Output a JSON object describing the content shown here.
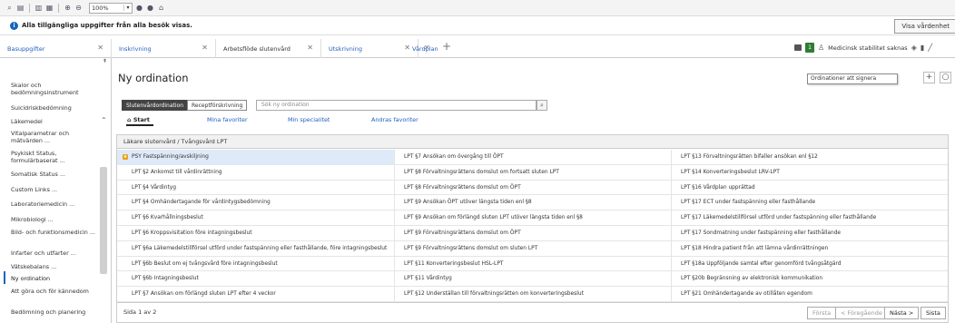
{
  "toolbar": {
    "zoom_value": "100%"
  },
  "infobar": {
    "message": "Alla tillgängliga uppgifter från alla besök visas.",
    "button_label": "Visa vårdenhet"
  },
  "tabs": [
    {
      "label": "Basuppgifter",
      "dark": false
    },
    {
      "label": "Inskrivning",
      "dark": false
    },
    {
      "label": "Arbetsflöde slutenvård",
      "dark": true
    },
    {
      "label": "Utskrivning",
      "dark": false
    },
    {
      "label": "Vårdplan",
      "dark": false
    }
  ],
  "header_status": {
    "medical_text": "Medicinsk stabilitet saknas"
  },
  "tooltip": "Ordinationer att signera",
  "sidebar": {
    "items": [
      "Skalor och bedömningsinstrument",
      "Suicidriskbedömning",
      "Läkemedel",
      "Vitalparametrar och mätvärden ...",
      "Psykiskt Status, formulärbaserat ...",
      "Somatisk Status ...",
      "Custom Links ...",
      "Laboratoriemedicin ...",
      "Mikrobiologi ...",
      "Bild- och funktionsmedicin ...",
      "Infarter och utfarter ...",
      "Vätskebalans ...",
      "Ny ordination",
      "Att göra och för kännedom",
      "Bedömning och planering"
    ]
  },
  "main": {
    "title": "Ny ordination",
    "subtabs": [
      "Slutenvårdordination",
      "Receptförskrivning"
    ],
    "search_placeholder": "Sök ny ordination",
    "nav": {
      "start": "Start",
      "favorites": "Mina favoriter",
      "specialty": "Min specialitet",
      "others": "Andras favoriter"
    },
    "breadcrumb": "Läkare slutenvård / Tvångsvård LPT",
    "rows": [
      [
        "PSY Fastspänning/avskiljning",
        "LPT §7 Ansökan om övergång till ÖPT",
        "LPT §13 Förvaltningsrätten bifaller ansökan enl §12"
      ],
      [
        "LPT §2 Ankomst till vårdinrättning",
        "LPT §8 Förvaltningsrättens domslut om fortsatt sluten LPT",
        "LPT §14 Konverteringsbeslut LRV-LPT"
      ],
      [
        "LPT §4 Vårdintyg",
        "LPT §8 Förvaltningsrättens domslut om ÖPT",
        "LPT §16 Vårdplan upprättad"
      ],
      [
        "LPT §4 Omhändertagande för vårdintygsbedömning",
        "LPT §9 Ansökan ÖPT utöver längsta tiden enl §8",
        "LPT §17 ECT under fastspänning eller fasthållande"
      ],
      [
        "LPT §6 Kvarhållningsbeslut",
        "LPT §9 Ansökan om förlängd sluten LPT utöver längsta tiden enl §8",
        "LPT §17 Läkemedelstillförsel utförd under fastspänning eller fasthållande"
      ],
      [
        "LPT §6 Kroppsvisitation före intagningsbeslut",
        "LPT §9 Förvaltningsrättens domslut om ÖPT",
        "LPT §17 Sondmatning under fastspänning eller fasthållande"
      ],
      [
        "LPT §6a Läkemedelstillförsel utförd under fastspänning eller fasthållande, före intagningsbeslut",
        "LPT §9 Förvaltningsrättens domslut om sluten LPT",
        "LPT §18 Hindra patient från att lämna vårdinrättningen"
      ],
      [
        "LPT §6b Beslut om ej tvångsvård före intagningsbeslut",
        "LPT §11 Konverteringsbeslut HSL-LPT",
        "LPT §18a Uppföljande samtal efter genomförd tvångsåtgärd"
      ],
      [
        "LPT §6b Intagningsbeslut",
        "LPT §11 Vårdintyg",
        "LPT §20b Begränsning av elektronisk kommunikation"
      ],
      [
        "LPT §7 Ansökan om förlängd sluten LPT efter 4 veckor",
        "LPT §12 Underställan till förvaltningsrätten om konverteringsbeslut",
        "LPT §21 Omhändertagande av otillåten egendom"
      ]
    ],
    "pager": {
      "text": "Sida 1 av 2",
      "first": "Första",
      "prev": "< Föregående",
      "next": "Nästa >",
      "last": "Sista"
    }
  }
}
